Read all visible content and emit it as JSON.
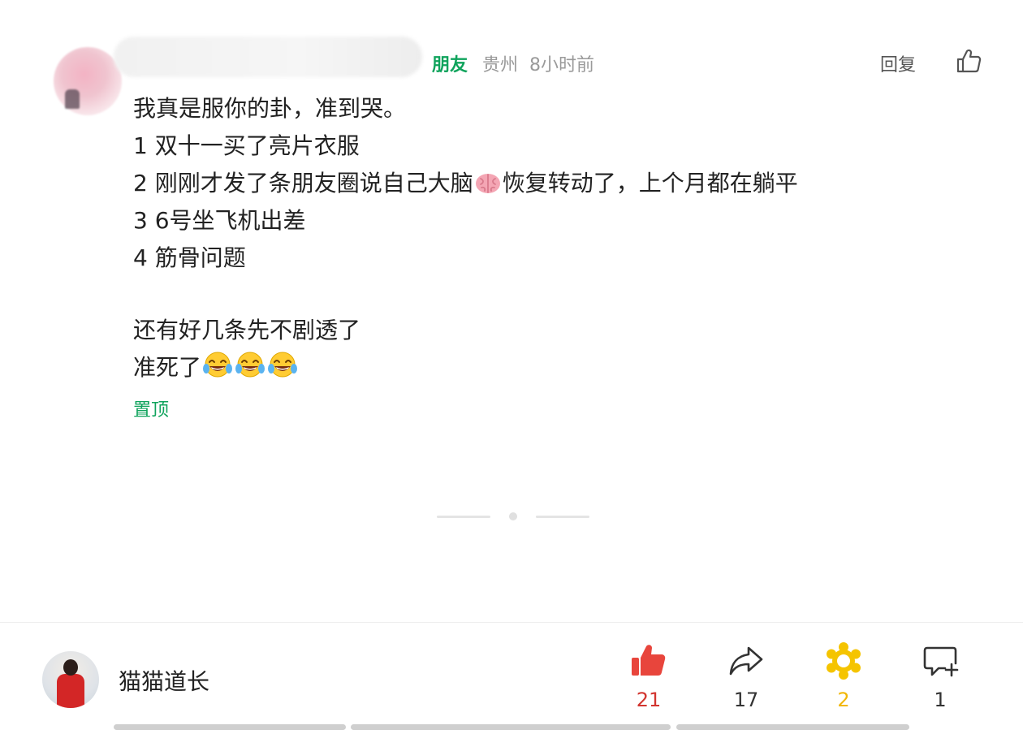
{
  "comment": {
    "tag": "朋友",
    "location": "贵州",
    "time": "8小时前",
    "reply_label": "回复",
    "lines": [
      "我真是服你的卦，准到哭。",
      "1 双十一买了亮片衣服",
      "2 刚刚才发了条朋友圈说自己大脑",
      "恢复转动了，上个月都在躺平",
      "3 6号坐飞机出差",
      "4 筋骨问题",
      "还有好几条先不剧透了",
      "准死了"
    ],
    "emojis": [
      "brain-emoji",
      "tears-of-joy-emoji"
    ],
    "pinned_label": "置顶"
  },
  "author": {
    "name": "猫猫道长"
  },
  "actions": {
    "like": {
      "count": "21",
      "icon": "thumbs-up-filled-icon",
      "color": "#e8453c"
    },
    "share": {
      "count": "17",
      "icon": "share-arrow-icon"
    },
    "reward": {
      "count": "2",
      "icon": "gold-flower-icon",
      "color": "#f5c400"
    },
    "comment": {
      "count": "1",
      "icon": "comment-add-icon"
    }
  },
  "colors": {
    "accent_green": "#0fa35c",
    "like_red": "#d2352f",
    "gold": "#f2b705"
  }
}
